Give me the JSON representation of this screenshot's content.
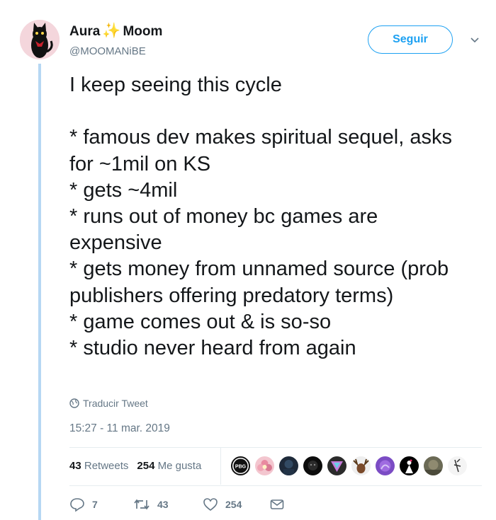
{
  "author": {
    "name_first": "Aura",
    "name_emoji": "✨",
    "name_last": "Moom",
    "handle": "@MOOMANiBE",
    "avatar_icon": "black-cat-avatar"
  },
  "follow_label": "Seguir",
  "tweet_text": "I keep seeing this cycle\n\n* famous dev makes spiritual sequel, asks for ~1mil on KS\n* gets ~4mil\n* runs out of money bc games are expensive\n* gets money from unnamed source (prob publishers offering predatory terms)\n* game comes out & is so-so\n* studio never heard from again",
  "translate_label": "Traducir Tweet",
  "timestamp": "15:27 - 11 mar. 2019",
  "stats": {
    "retweets_count": "43",
    "retweets_label": "Retweets",
    "likes_count": "254",
    "likes_label": "Me gusta"
  },
  "likers": [
    {
      "icon": "pbg-logo-avatar",
      "badge": "PBG"
    },
    {
      "icon": "flower-avatar"
    },
    {
      "icon": "dark-character-avatar"
    },
    {
      "icon": "dark-face-avatar"
    },
    {
      "icon": "triangle-avatar"
    },
    {
      "icon": "moose-avatar"
    },
    {
      "icon": "purple-shape-avatar"
    },
    {
      "icon": "black-figure-avatar"
    },
    {
      "icon": "photo-avatar"
    },
    {
      "icon": "sketch-avatar"
    }
  ],
  "actions": {
    "reply_count": "7",
    "retweet_count": "43",
    "like_count": "254"
  },
  "colors": {
    "accent": "#1da1f2",
    "muted": "#657786",
    "thread_line": "#b6d7f3",
    "star": "#f5b80f"
  }
}
